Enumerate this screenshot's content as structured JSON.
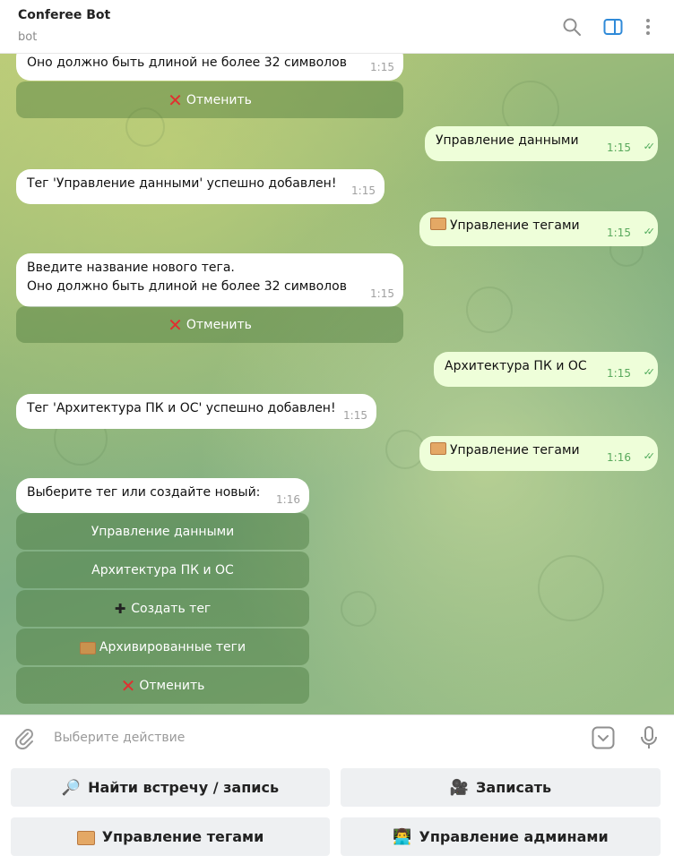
{
  "header": {
    "title": "Conferee Bot",
    "subtitle": "bot",
    "icons": [
      "search-icon",
      "sidebar-toggle-icon",
      "more-vert-icon"
    ],
    "accent": "#2f8ad8"
  },
  "messages": [
    {
      "dir": "in",
      "text": "Оно должно быть длиной не более 32 символов",
      "time": "1:15"
    },
    {
      "dir": "in-kb",
      "cancel": "Отменить"
    },
    {
      "dir": "out",
      "text": "Управление данными",
      "time": "1:15"
    },
    {
      "dir": "in",
      "text": "Тег 'Управление данными' успешно добавлен!",
      "time": "1:15"
    },
    {
      "dir": "out",
      "text": "Управление тегами",
      "time": "1:15"
    },
    {
      "dir": "in",
      "text_line1": "Введите название нового тега.",
      "text_line2": "Оно должно быть длиной не более 32 символов",
      "time": "1:15"
    },
    {
      "dir": "in-kb",
      "cancel": "Отменить"
    },
    {
      "dir": "out",
      "text": "Архитектура ПК и ОС",
      "time": "1:15"
    },
    {
      "dir": "in",
      "text": "Тег 'Архитектура ПК и ОС' успешно добавлен!",
      "time": "1:15"
    },
    {
      "dir": "out",
      "text": "Управление тегами",
      "time": "1:16"
    },
    {
      "dir": "in",
      "text": "Выберите тег или создайте новый:",
      "time": "1:16"
    }
  ],
  "inline_keyboard": {
    "tag1": "Управление данными",
    "tag2": "Архитектура ПК и ОС",
    "create": "Создать тег",
    "archived": "Архивированные теги",
    "cancel": "Отменить"
  },
  "composer": {
    "placeholder": "Выберите действие"
  },
  "reply_keyboard": {
    "find": "Найти встречу / запись",
    "record": "Записать",
    "tags": "Управление тегами",
    "admins": "Управление админами"
  },
  "colors": {
    "outgoing_bubble": "#eefed9",
    "incoming_bubble": "#ffffff",
    "check": "#4faa5b",
    "cancel_x": "#e03030"
  }
}
